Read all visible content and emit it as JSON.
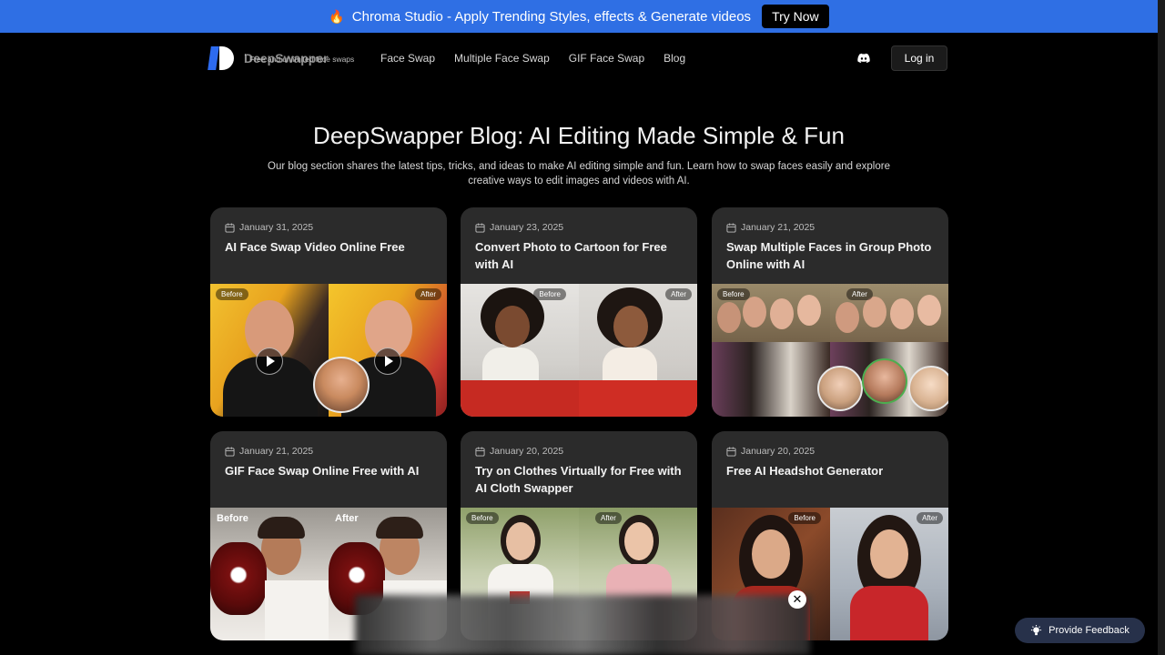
{
  "banner": {
    "text": "Chroma Studio - Apply Trending Styles, effects & Generate videos",
    "cta": "Try Now",
    "icon": "flame-icon"
  },
  "nav": {
    "brand": "DeepSwapper",
    "tagline": "Free and unlimited face swaps",
    "links": [
      "Face Swap",
      "Multiple Face Swap",
      "GIF Face Swap",
      "Blog"
    ],
    "login": "Log in"
  },
  "hero": {
    "title": "DeepSwapper Blog: AI Editing Made Simple & Fun",
    "subtitle": "Our blog section shares the latest tips, tricks, and ideas to make AI editing simple and fun. Learn how to swap faces easily and explore creative ways to edit images and videos with AI."
  },
  "cards": [
    {
      "date": "January 31, 2025",
      "title": "AI Face Swap Video Online Free",
      "before": "Before",
      "after": "After"
    },
    {
      "date": "January 23, 2025",
      "title": "Convert Photo to Cartoon for Free with AI",
      "before": "Before",
      "after": "After"
    },
    {
      "date": "January 21, 2025",
      "title": "Swap Multiple Faces in Group Photo Online with AI",
      "before": "Before",
      "after": "After"
    },
    {
      "date": "January 21, 2025",
      "title": "GIF Face Swap Online Free with AI",
      "before": "Before",
      "after": "After"
    },
    {
      "date": "January 20, 2025",
      "title": "Try on Clothes Virtually for Free with AI Cloth Swapper",
      "before": "Before",
      "after": "After"
    },
    {
      "date": "January 20, 2025",
      "title": "Free AI Headshot Generator",
      "before": "Before",
      "after": "After"
    }
  ],
  "feedback": "Provide Feedback",
  "colors": {
    "banner": "#2f6fe4",
    "card": "#2b2b2b",
    "background": "#000000",
    "feedback": "#27314a"
  }
}
